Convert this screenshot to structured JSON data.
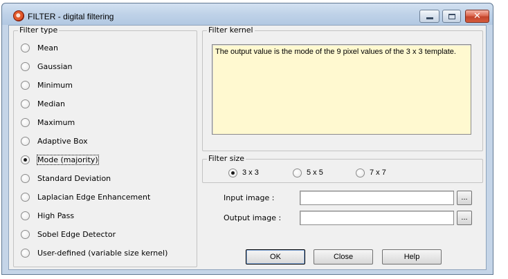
{
  "window": {
    "title": "FILTER - digital filtering",
    "icon": "filter-app-icon",
    "controls": {
      "minimize_icon": "minimize-icon",
      "maximize_icon": "maximize-icon",
      "close_glyph": "✕"
    }
  },
  "filter_type": {
    "legend": "Filter type",
    "selected": "Mode (majority)",
    "options": [
      "Mean",
      "Gaussian",
      "Minimum",
      "Median",
      "Maximum",
      "Adaptive Box",
      "Mode (majority)",
      "Standard Deviation",
      "Laplacian Edge Enhancement",
      "High Pass",
      "Sobel Edge Detector",
      "User-defined (variable size kernel)"
    ]
  },
  "filter_kernel": {
    "legend": "Filter kernel",
    "text": "The output value is the mode of the 9 pixel values of the 3 x 3 template.",
    "background": "#fff9d0"
  },
  "filter_size": {
    "legend": "Filter size",
    "selected": "3 x 3",
    "options": [
      "3 x 3",
      "5 x 5",
      "7 x 7"
    ]
  },
  "input_image": {
    "label": "Input image :",
    "value": "",
    "browse_label": "..."
  },
  "output_image": {
    "label": "Output image :",
    "value": "",
    "browse_label": "..."
  },
  "buttons": {
    "ok": "OK",
    "close": "Close",
    "help": "Help"
  }
}
